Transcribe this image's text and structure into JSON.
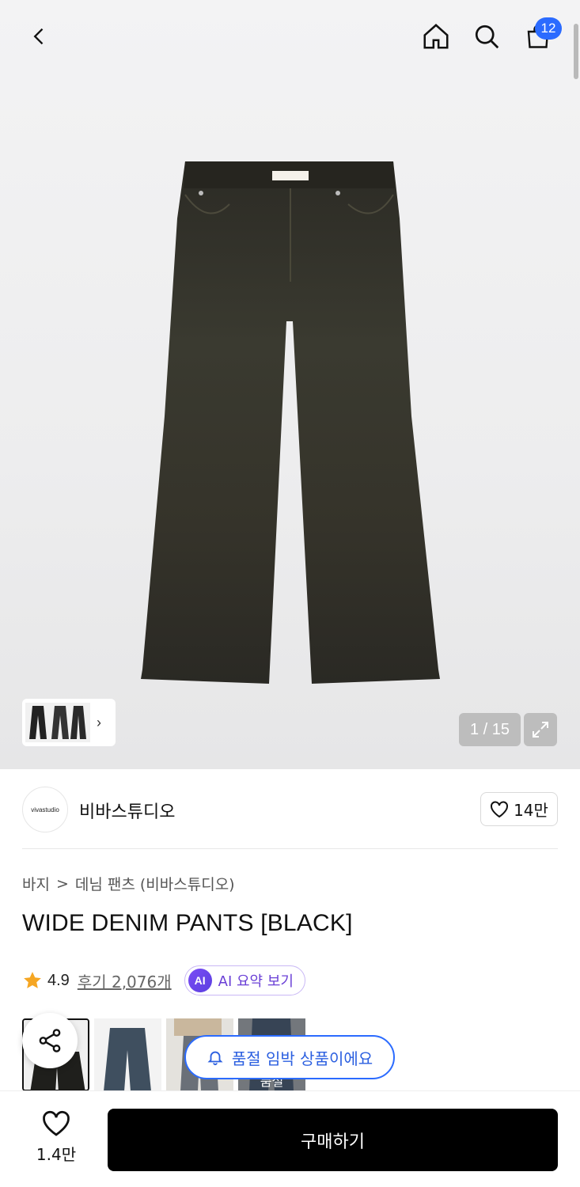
{
  "header": {
    "back_icon": "chevron-left-icon",
    "home_icon": "home-icon",
    "search_icon": "search-icon",
    "cart_icon": "shopping-bag-icon",
    "cart_count": "12"
  },
  "gallery": {
    "counter": "1 / 15",
    "expand_icon": "expand-icon",
    "thumb_strip_chevron": "›"
  },
  "brand": {
    "logo_text": "vivastudio",
    "name": "비바스튜디오",
    "like_count": "14만"
  },
  "product": {
    "breadcrumb": [
      "바지",
      "데님 팬츠 (비바스튜디오)"
    ],
    "breadcrumb_sep": ">",
    "title": "WIDE DENIM PANTS [BLACK]",
    "rating": "4.9",
    "reviews": "후기 2,076개",
    "ai_badge": "AI",
    "ai_label": "AI 요약 보기"
  },
  "options": {
    "sold_out_label": "품절"
  },
  "toast": {
    "text": "품절 임박 상품이에요"
  },
  "footer": {
    "wish_count": "1.4만",
    "buy_label": "구매하기"
  },
  "colors": {
    "accent_blue": "#2b6bff",
    "ai_purple": "#6a3fd6",
    "star": "#f5a623",
    "buy_bg": "#000000"
  }
}
